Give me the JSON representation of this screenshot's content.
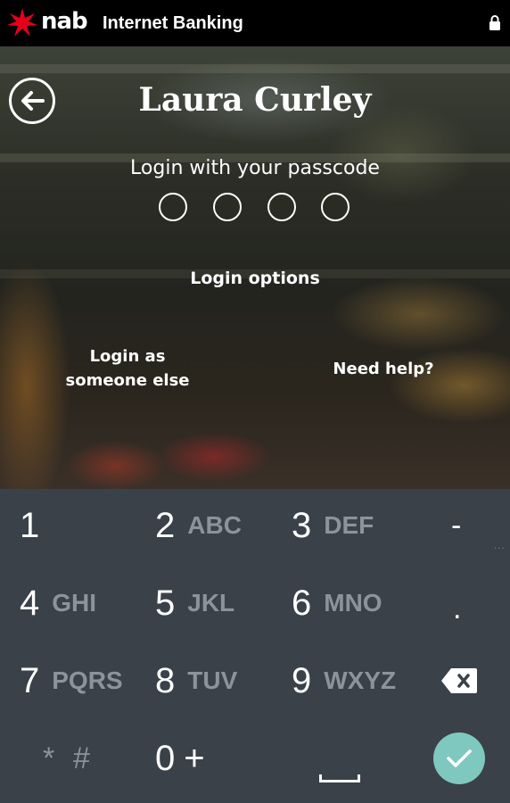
{
  "header": {
    "brand": "nab",
    "title": "Internet Banking",
    "lock_icon": "lock-icon"
  },
  "login": {
    "user_name": "Laura Curley",
    "prompt": "Login with your passcode",
    "passcode_length": 4,
    "options_label": "Login options",
    "login_else_line1": "Login as",
    "login_else_line2": "someone else",
    "help_label": "Need help?"
  },
  "keypad": {
    "keys": [
      {
        "digit": "1",
        "letters": ""
      },
      {
        "digit": "2",
        "letters": "ABC"
      },
      {
        "digit": "3",
        "letters": "DEF"
      },
      {
        "digit": "4",
        "letters": "GHI"
      },
      {
        "digit": "5",
        "letters": "JKL"
      },
      {
        "digit": "6",
        "letters": "MNO"
      },
      {
        "digit": "7",
        "letters": "PQRS"
      },
      {
        "digit": "8",
        "letters": "TUV"
      },
      {
        "digit": "9",
        "letters": "WXYZ"
      },
      {
        "digit": "0",
        "letters": "+"
      }
    ],
    "star": "*",
    "hash": "#",
    "minus": "-",
    "period": ".",
    "ellipsis": "...",
    "icons": {
      "backspace": "backspace-icon",
      "space": "space-icon",
      "enter": "check-icon"
    }
  },
  "colors": {
    "keypad_bg": "#3a4148",
    "enter_button": "#7fc8c0",
    "brand_red": "#e3001b"
  }
}
